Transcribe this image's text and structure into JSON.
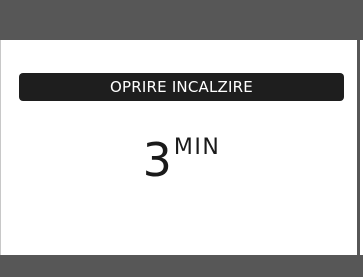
{
  "screen": {
    "label": "OPRIRE INCALZIRE",
    "value": "3",
    "unit": "MIN"
  },
  "colors": {
    "bar": "#575757",
    "label_background": "#1e1e1e",
    "label_text": "#ffffff",
    "value_text": "#1a1a1a",
    "background": "#ffffff"
  }
}
